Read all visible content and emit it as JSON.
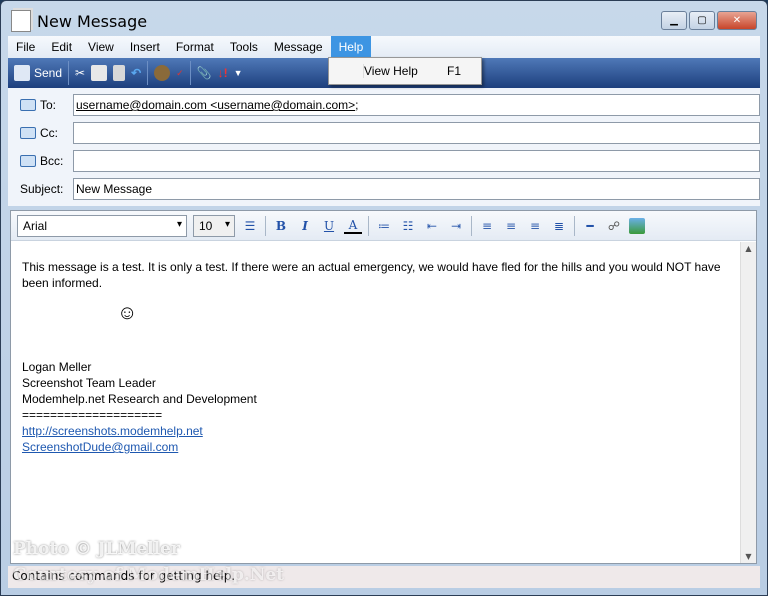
{
  "window": {
    "title": "New Message"
  },
  "menu": [
    "File",
    "Edit",
    "View",
    "Insert",
    "Format",
    "Tools",
    "Message",
    "Help"
  ],
  "toolbar": {
    "send": "Send"
  },
  "help_menu": {
    "item": "View Help",
    "shortcut": "F1"
  },
  "headers": {
    "to_label": "To:",
    "to_value": "username@domain.com <username@domain.com>",
    "to_suffix": ";",
    "cc_label": "Cc:",
    "bcc_label": "Bcc:",
    "subject_label": "Subject:",
    "subject_value": "New Message"
  },
  "format": {
    "font": "Arial",
    "size": "10",
    "bold": "B",
    "italic": "I",
    "underline": "U",
    "color": "A"
  },
  "body": {
    "p1": "This message is a test.  It is only a test.  If there were an actual emergency, we would have fled for the hills and you would NOT have been informed.",
    "smiley": "☺",
    "sig": [
      "Logan Meller",
      "Screenshot Team Leader",
      "Modemhelp.net Research and Development",
      "===================="
    ],
    "link1": "http://screenshots.modemhelp.net",
    "link2": "ScreenshotDude@gmail.com"
  },
  "status": "Contains commands for getting help.",
  "watermark": {
    "line1": "Photo © JLMeller",
    "line2": "Courtesy of ModemHelp.Net"
  }
}
